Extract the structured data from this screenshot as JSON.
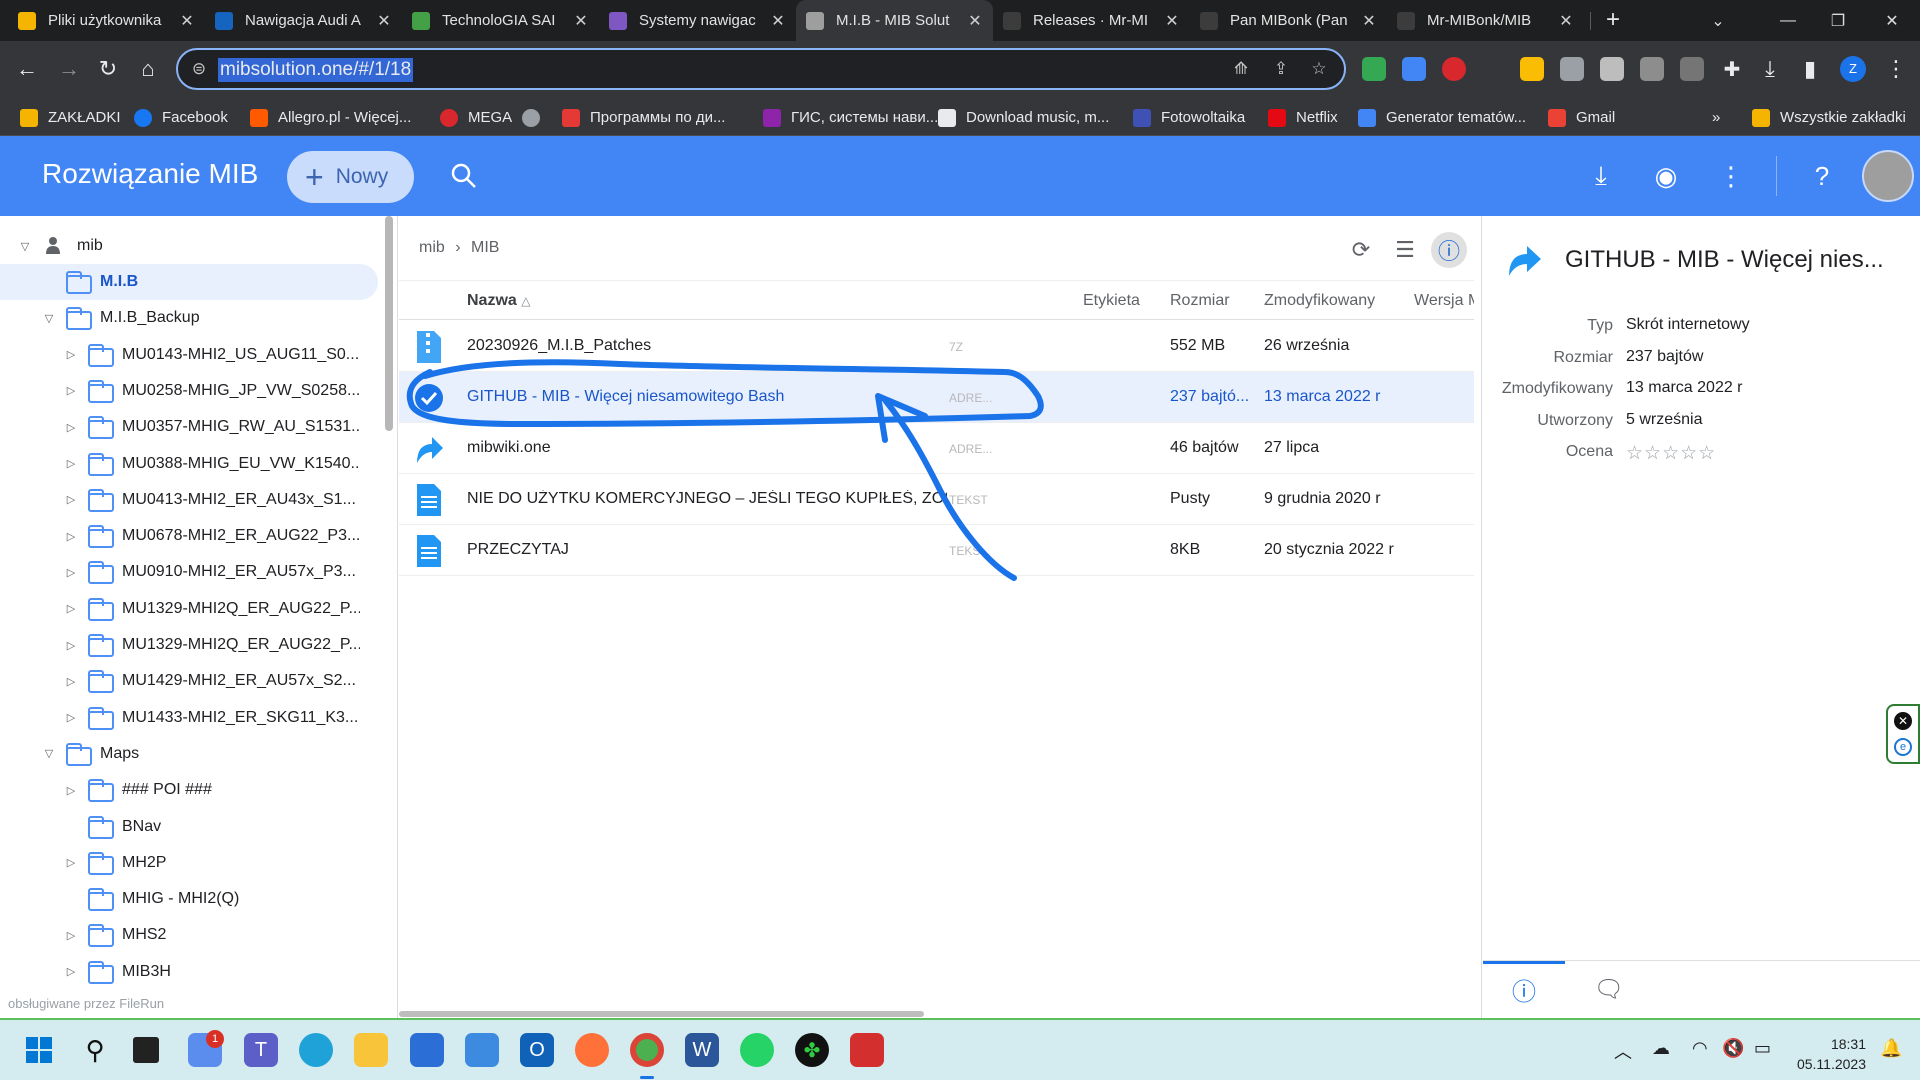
{
  "browser": {
    "tabs": [
      {
        "title": "Pliki użytkownika",
        "color": "#f4b400"
      },
      {
        "title": "Nawigacja Audi A",
        "color": "#1565c0"
      },
      {
        "title": "TechnoloGIA SAI",
        "color": "#43a047"
      },
      {
        "title": "Systemy nawigac",
        "color": "#7e57c2"
      },
      {
        "title": "M.I.B - MIB Solut",
        "color": "#9e9e9e"
      },
      {
        "title": "Releases · Mr-MI",
        "color": "#3c3c3c"
      },
      {
        "title": "Pan MIBonk (Pan",
        "color": "#3c3c3c"
      },
      {
        "title": "Mr-MIBonk/MIB",
        "color": "#3c3c3c"
      }
    ],
    "active_tab_index": 4,
    "url": "mibsolution.one/#/1/18",
    "bookmarks": [
      {
        "label": "ZAKŁADKI",
        "color": "#f4b400"
      },
      {
        "label": "Facebook",
        "color": "#1877f2"
      },
      {
        "label": "Allegro.pl - Więcej...",
        "color": "#ff5a00"
      },
      {
        "label": "MEGA",
        "color": "#d9272e"
      },
      {
        "label": "",
        "color": "#9aa0a6"
      },
      {
        "label": "Программы по ди...",
        "color": "#e53935"
      },
      {
        "label": "ГИС, системы нави...",
        "color": "#8e24aa"
      },
      {
        "label": "Download music, m...",
        "color": "#e8eaed"
      },
      {
        "label": "Fotowoltaika",
        "color": "#3f51b5"
      },
      {
        "label": "Netflix",
        "color": "#e50914"
      },
      {
        "label": "Generator tematów...",
        "color": "#4285f4"
      },
      {
        "label": "Gmail",
        "color": "#ea4335"
      }
    ],
    "bookmarks_more": "»",
    "all_bookmarks": "Wszystkie zakładki",
    "profile_initial": "Z"
  },
  "app": {
    "title": "Rozwiązanie MIB",
    "new_label": "Nowy",
    "accent": "#4285f4"
  },
  "sidebar": {
    "root": "mib",
    "items": [
      {
        "label": "M.I.B",
        "depth": 1,
        "toggle": "none",
        "selected": true
      },
      {
        "label": "M.I.B_Backup",
        "depth": 1,
        "toggle": "open",
        "selected": false
      },
      {
        "label": "MU0143-MHI2_US_AUG11_S0...",
        "depth": 2,
        "toggle": "closed"
      },
      {
        "label": "MU0258-MHIG_JP_VW_S0258...",
        "depth": 2,
        "toggle": "closed"
      },
      {
        "label": "MU0357-MHIG_RW_AU_S1531...",
        "depth": 2,
        "toggle": "closed"
      },
      {
        "label": "MU0388-MHIG_EU_VW_K1540...",
        "depth": 2,
        "toggle": "closed"
      },
      {
        "label": "MU0413-MHI2_ER_AU43x_S1...",
        "depth": 2,
        "toggle": "closed"
      },
      {
        "label": "MU0678-MHI2_ER_AUG22_P3...",
        "depth": 2,
        "toggle": "closed"
      },
      {
        "label": "MU0910-MHI2_ER_AU57x_P3...",
        "depth": 2,
        "toggle": "closed"
      },
      {
        "label": "MU1329-MHI2Q_ER_AUG22_P...",
        "depth": 2,
        "toggle": "closed"
      },
      {
        "label": "MU1329-MHI2Q_ER_AUG22_P...",
        "depth": 2,
        "toggle": "closed"
      },
      {
        "label": "MU1429-MHI2_ER_AU57x_S2...",
        "depth": 2,
        "toggle": "closed"
      },
      {
        "label": "MU1433-MHI2_ER_SKG11_K3...",
        "depth": 2,
        "toggle": "closed"
      },
      {
        "label": "Maps",
        "depth": 1,
        "toggle": "open"
      },
      {
        "label": "### POI ###",
        "depth": 2,
        "toggle": "closed"
      },
      {
        "label": "BNav",
        "depth": 2,
        "toggle": "none"
      },
      {
        "label": "MH2P",
        "depth": 2,
        "toggle": "closed"
      },
      {
        "label": "MHIG - MHI2(Q)",
        "depth": 2,
        "toggle": "none"
      },
      {
        "label": "MHS2",
        "depth": 2,
        "toggle": "closed"
      },
      {
        "label": "MIB3H",
        "depth": 2,
        "toggle": "closed"
      }
    ],
    "powered_by": "obsługiwane przez FileRun"
  },
  "main": {
    "breadcrumb": [
      "mib",
      "MIB"
    ],
    "columns": {
      "name": "Nazwa",
      "label": "Etykieta",
      "size": "Rozmiar",
      "modified": "Zmodyfikowany",
      "version": "Wersja M"
    },
    "rows": [
      {
        "name": "20230926_M.I.B_Patches",
        "type": "7Z",
        "size": "552 MB",
        "modified": "26 września",
        "icon": "zip",
        "selected": false
      },
      {
        "name": "GITHUB - MIB - Więcej niesamowitego Bash",
        "type": "ADRE...",
        "size": "237 bajtó...",
        "modified": "13 marca 2022 r",
        "icon": "check",
        "selected": true
      },
      {
        "name": "mibwiki.one",
        "type": "ADRE...",
        "size": "46 bajtów",
        "modified": "27 lipca",
        "icon": "link",
        "selected": false
      },
      {
        "name": "NIE DO UŻYTKU KOMERCYJNEGO – JEŚLI TEGO KUPIŁEŚ, ZOS...",
        "type": "TEKST",
        "size": "Pusty",
        "modified": "9 grudnia 2020 r",
        "icon": "doc",
        "selected": false
      },
      {
        "name": "PRZECZYTAJ",
        "type": "TEKS...",
        "size": "8KB",
        "modified": "20 stycznia 2022 r",
        "icon": "doc",
        "selected": false
      }
    ]
  },
  "details": {
    "title": "GITHUB - MIB - Więcej nies...",
    "props": [
      {
        "key": "Typ",
        "value": "Skrót internetowy"
      },
      {
        "key": "Rozmiar",
        "value": "237 bajtów"
      },
      {
        "key": "Zmodyfikowany",
        "value": "13 marca 2022 r"
      },
      {
        "key": "Utworzony",
        "value": "5 września"
      },
      {
        "key": "Ocena",
        "value": "☆☆☆☆☆"
      }
    ]
  },
  "taskbar": {
    "time": "18:31",
    "date": "05.11.2023",
    "badge": "1"
  },
  "annotation_color": "#1a73e8"
}
